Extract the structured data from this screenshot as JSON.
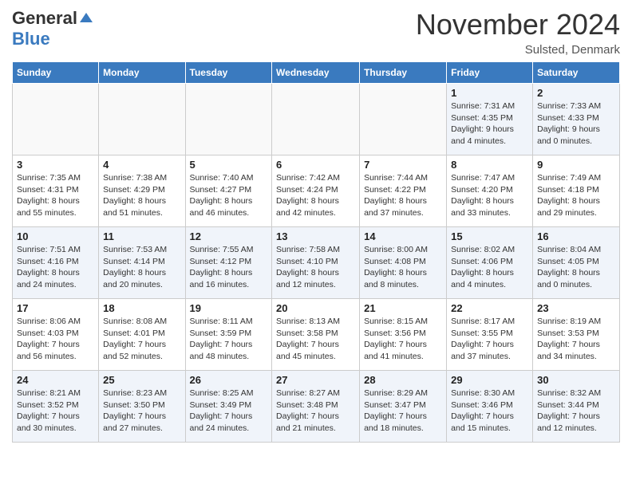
{
  "header": {
    "logo_general": "General",
    "logo_blue": "Blue",
    "month_title": "November 2024",
    "location": "Sulsted, Denmark"
  },
  "weekdays": [
    "Sunday",
    "Monday",
    "Tuesday",
    "Wednesday",
    "Thursday",
    "Friday",
    "Saturday"
  ],
  "weeks": [
    [
      {
        "day": "",
        "info": ""
      },
      {
        "day": "",
        "info": ""
      },
      {
        "day": "",
        "info": ""
      },
      {
        "day": "",
        "info": ""
      },
      {
        "day": "",
        "info": ""
      },
      {
        "day": "1",
        "info": "Sunrise: 7:31 AM\nSunset: 4:35 PM\nDaylight: 9 hours\nand 4 minutes."
      },
      {
        "day": "2",
        "info": "Sunrise: 7:33 AM\nSunset: 4:33 PM\nDaylight: 9 hours\nand 0 minutes."
      }
    ],
    [
      {
        "day": "3",
        "info": "Sunrise: 7:35 AM\nSunset: 4:31 PM\nDaylight: 8 hours\nand 55 minutes."
      },
      {
        "day": "4",
        "info": "Sunrise: 7:38 AM\nSunset: 4:29 PM\nDaylight: 8 hours\nand 51 minutes."
      },
      {
        "day": "5",
        "info": "Sunrise: 7:40 AM\nSunset: 4:27 PM\nDaylight: 8 hours\nand 46 minutes."
      },
      {
        "day": "6",
        "info": "Sunrise: 7:42 AM\nSunset: 4:24 PM\nDaylight: 8 hours\nand 42 minutes."
      },
      {
        "day": "7",
        "info": "Sunrise: 7:44 AM\nSunset: 4:22 PM\nDaylight: 8 hours\nand 37 minutes."
      },
      {
        "day": "8",
        "info": "Sunrise: 7:47 AM\nSunset: 4:20 PM\nDaylight: 8 hours\nand 33 minutes."
      },
      {
        "day": "9",
        "info": "Sunrise: 7:49 AM\nSunset: 4:18 PM\nDaylight: 8 hours\nand 29 minutes."
      }
    ],
    [
      {
        "day": "10",
        "info": "Sunrise: 7:51 AM\nSunset: 4:16 PM\nDaylight: 8 hours\nand 24 minutes."
      },
      {
        "day": "11",
        "info": "Sunrise: 7:53 AM\nSunset: 4:14 PM\nDaylight: 8 hours\nand 20 minutes."
      },
      {
        "day": "12",
        "info": "Sunrise: 7:55 AM\nSunset: 4:12 PM\nDaylight: 8 hours\nand 16 minutes."
      },
      {
        "day": "13",
        "info": "Sunrise: 7:58 AM\nSunset: 4:10 PM\nDaylight: 8 hours\nand 12 minutes."
      },
      {
        "day": "14",
        "info": "Sunrise: 8:00 AM\nSunset: 4:08 PM\nDaylight: 8 hours\nand 8 minutes."
      },
      {
        "day": "15",
        "info": "Sunrise: 8:02 AM\nSunset: 4:06 PM\nDaylight: 8 hours\nand 4 minutes."
      },
      {
        "day": "16",
        "info": "Sunrise: 8:04 AM\nSunset: 4:05 PM\nDaylight: 8 hours\nand 0 minutes."
      }
    ],
    [
      {
        "day": "17",
        "info": "Sunrise: 8:06 AM\nSunset: 4:03 PM\nDaylight: 7 hours\nand 56 minutes."
      },
      {
        "day": "18",
        "info": "Sunrise: 8:08 AM\nSunset: 4:01 PM\nDaylight: 7 hours\nand 52 minutes."
      },
      {
        "day": "19",
        "info": "Sunrise: 8:11 AM\nSunset: 3:59 PM\nDaylight: 7 hours\nand 48 minutes."
      },
      {
        "day": "20",
        "info": "Sunrise: 8:13 AM\nSunset: 3:58 PM\nDaylight: 7 hours\nand 45 minutes."
      },
      {
        "day": "21",
        "info": "Sunrise: 8:15 AM\nSunset: 3:56 PM\nDaylight: 7 hours\nand 41 minutes."
      },
      {
        "day": "22",
        "info": "Sunrise: 8:17 AM\nSunset: 3:55 PM\nDaylight: 7 hours\nand 37 minutes."
      },
      {
        "day": "23",
        "info": "Sunrise: 8:19 AM\nSunset: 3:53 PM\nDaylight: 7 hours\nand 34 minutes."
      }
    ],
    [
      {
        "day": "24",
        "info": "Sunrise: 8:21 AM\nSunset: 3:52 PM\nDaylight: 7 hours\nand 30 minutes."
      },
      {
        "day": "25",
        "info": "Sunrise: 8:23 AM\nSunset: 3:50 PM\nDaylight: 7 hours\nand 27 minutes."
      },
      {
        "day": "26",
        "info": "Sunrise: 8:25 AM\nSunset: 3:49 PM\nDaylight: 7 hours\nand 24 minutes."
      },
      {
        "day": "27",
        "info": "Sunrise: 8:27 AM\nSunset: 3:48 PM\nDaylight: 7 hours\nand 21 minutes."
      },
      {
        "day": "28",
        "info": "Sunrise: 8:29 AM\nSunset: 3:47 PM\nDaylight: 7 hours\nand 18 minutes."
      },
      {
        "day": "29",
        "info": "Sunrise: 8:30 AM\nSunset: 3:46 PM\nDaylight: 7 hours\nand 15 minutes."
      },
      {
        "day": "30",
        "info": "Sunrise: 8:32 AM\nSunset: 3:44 PM\nDaylight: 7 hours\nand 12 minutes."
      }
    ]
  ]
}
